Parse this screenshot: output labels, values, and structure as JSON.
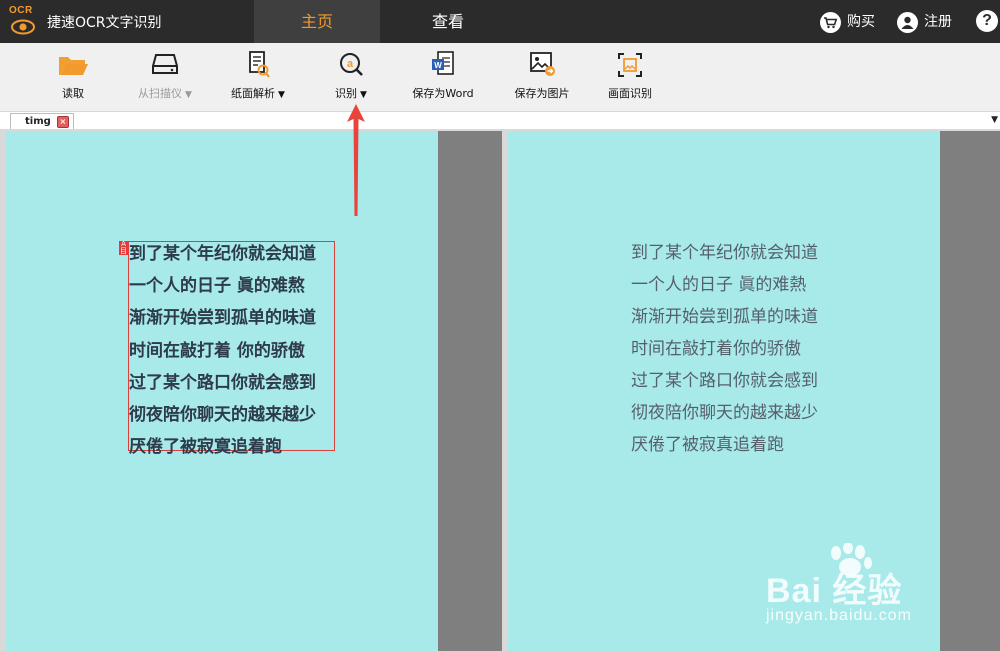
{
  "app": {
    "logo_text": "OCR",
    "title": "捷速OCR文字识别"
  },
  "nav": {
    "tabs": [
      {
        "label": "主页",
        "active": true
      },
      {
        "label": "查看",
        "active": false
      }
    ]
  },
  "top_actions": {
    "buy": "购买",
    "register": "注册",
    "help": "?"
  },
  "toolbar": {
    "items": [
      {
        "label": "读取",
        "icon": "folder-open-icon",
        "enabled": true
      },
      {
        "label": "从扫描仪",
        "icon": "scanner-icon",
        "enabled": false,
        "dropdown": true
      },
      {
        "label": "纸面解析",
        "icon": "page-analyze-icon",
        "enabled": true,
        "dropdown": true
      },
      {
        "label": "识别",
        "icon": "recognize-icon",
        "enabled": true,
        "dropdown": true
      },
      {
        "label": "保存为Word",
        "icon": "word-doc-icon",
        "enabled": true
      },
      {
        "label": "保存为图片",
        "icon": "save-image-icon",
        "enabled": true
      },
      {
        "label": "画面识别",
        "icon": "screen-capture-icon",
        "enabled": true
      }
    ],
    "dropdown_caret": "▼"
  },
  "document_tab": {
    "name": "timg"
  },
  "source_text_lines": [
    "到了某个年纪你就会知道",
    "一个人的日子 眞的难熬",
    "渐渐开始尝到孤单的味道",
    "时间在敲打着 你的骄傲",
    "过了某个路口你就会感到",
    "彻夜陪你聊天的越来越少",
    "厌倦了被寂寞追着跑"
  ],
  "result_text_lines": [
    "到了某个年纪你就会知道",
    "一个人的日子  眞的难熱",
    "渐渐开始尝到孤单的味道",
    "时间在敲打着你的骄傲",
    "过了某个路口你就会感到",
    "彻夜陪你聊天的越来越少",
    "厌倦了被寂真追着跑"
  ],
  "colors": {
    "topbar_bg": "#2b2b2b",
    "accent": "#f29a2e",
    "image_bg": "#a8eaea",
    "selection_border": "#d94040",
    "arrow": "#e8433c"
  },
  "watermark": {
    "main": "Bai  经验",
    "sub": "jingyan.baidu.com"
  }
}
